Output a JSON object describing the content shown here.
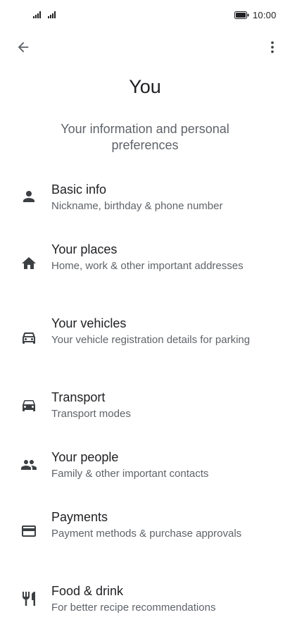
{
  "status_bar": {
    "time": "10:00",
    "signal_icons": [
      "signal-1-icon",
      "signal-2-icon"
    ],
    "battery_icon": "battery-icon"
  },
  "toolbar": {
    "back_icon": "arrow-back-icon",
    "more_icon": "more-vert-icon"
  },
  "header": {
    "title": "You",
    "subtitle": "Your information and personal preferences"
  },
  "menu": {
    "items": [
      {
        "icon": "person-icon",
        "title": "Basic info",
        "description": "Nickname, birthday & phone number"
      },
      {
        "icon": "home-icon",
        "title": "Your places",
        "description": "Home, work & other important addresses"
      },
      {
        "icon": "car-outline-icon",
        "title": "Your vehicles",
        "description": "Your vehicle registration details for parking"
      },
      {
        "icon": "car-icon",
        "title": "Transport",
        "description": "Transport modes"
      },
      {
        "icon": "people-icon",
        "title": "Your people",
        "description": "Family & other important contacts"
      },
      {
        "icon": "credit-card-icon",
        "title": "Payments",
        "description": "Payment methods & purchase approvals"
      },
      {
        "icon": "restaurant-icon",
        "title": "Food & drink",
        "description": "For better recipe recommendations"
      }
    ]
  },
  "colors": {
    "primary_text": "#202124",
    "secondary_text": "#5f6368",
    "icon": "#3c4043",
    "background": "#ffffff"
  }
}
